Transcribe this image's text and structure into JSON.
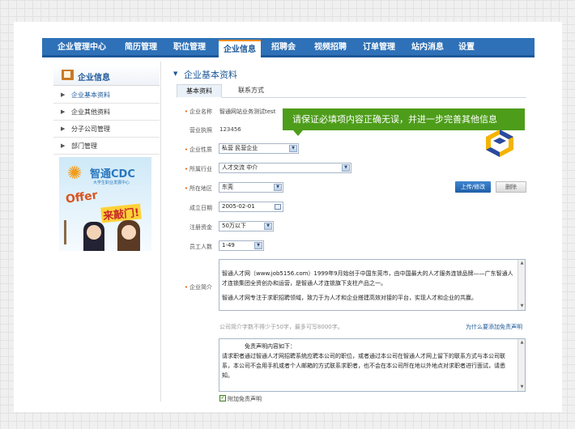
{
  "nav": {
    "items": [
      "企业管理中心",
      "简历管理",
      "职位管理",
      "企业信息",
      "招聘会",
      "视频招聘",
      "订单管理",
      "站内消息",
      "设置"
    ],
    "active": "企业信息"
  },
  "sidebar": {
    "title": "企业信息",
    "items": [
      {
        "label": "企业基本资料",
        "active": true
      },
      {
        "label": "企业其他资料",
        "active": false
      },
      {
        "label": "分子公司管理",
        "active": false
      },
      {
        "label": "部门管理",
        "active": false
      }
    ],
    "banner": {
      "brand": "智通CDC",
      "subtitle": "大学生职业发展中心",
      "offer": "Offer",
      "slogan": "来敲门!"
    }
  },
  "section_title": "企业基本资料",
  "tabs": [
    "基本资料",
    "联系方式"
  ],
  "tooltip": "请保证必填项内容正确无误，并进一步完善其他信息",
  "form": {
    "company_name": {
      "label": "企业名称",
      "value": "智通网站业务测试test",
      "required": true
    },
    "license": {
      "label": "营业执照",
      "value": "123456",
      "required": false
    },
    "nature": {
      "label": "企业性质",
      "value": "私营 民营企业",
      "required": true
    },
    "industry": {
      "label": "所属行业",
      "value": "人才交流 中介",
      "required": true
    },
    "region": {
      "label": "所在地区",
      "value": "东莞",
      "required": true
    },
    "founded": {
      "label": "成立日期",
      "value": "2005-02-01",
      "required": false
    },
    "capital": {
      "label": "注册资金",
      "value": "50万以下",
      "required": false
    },
    "staff": {
      "label": "员工人数",
      "value": "1-49",
      "required": false
    },
    "intro": {
      "label": "企业简介",
      "required": true,
      "paragraphs": [
        "智通人才网（www.job5156.com）1999年9月始创于中国东莞市，由中国最大的人才服务连锁品牌——广东智通人才连锁集团全资创办和运营，是智通人才连锁旗下支柱产品之一。",
        "智通人才网专注于求职招聘领域，致力于为人才和企业搭建高效对接的平台，实现人才和企业的共赢。"
      ]
    },
    "intro_hint": "公司简介字数不得少于50字，最多可写8000字。",
    "disclaimer_link": "为什么要添加免责声明",
    "disclaimer": {
      "title": "免责声明内容如下：",
      "text": "请求职者通过智通人才网招聘系统应聘本公司的职位，或者通过本公司在智通人才网上留下的联系方式与本公司联系，本公司不会用手机或者个人邮箱的方式联系求职者，也不会在本公司所在地以外地点对求职者进行面试，请悉知。"
    },
    "checkbox_label": "附加免责声明"
  },
  "buttons": {
    "upload": "上传/修改",
    "delete": "删除"
  },
  "colors": {
    "nav": "#2e71b8",
    "accent": "#f08a00",
    "tooltip": "#4d9d1a",
    "link": "#1c5799"
  }
}
